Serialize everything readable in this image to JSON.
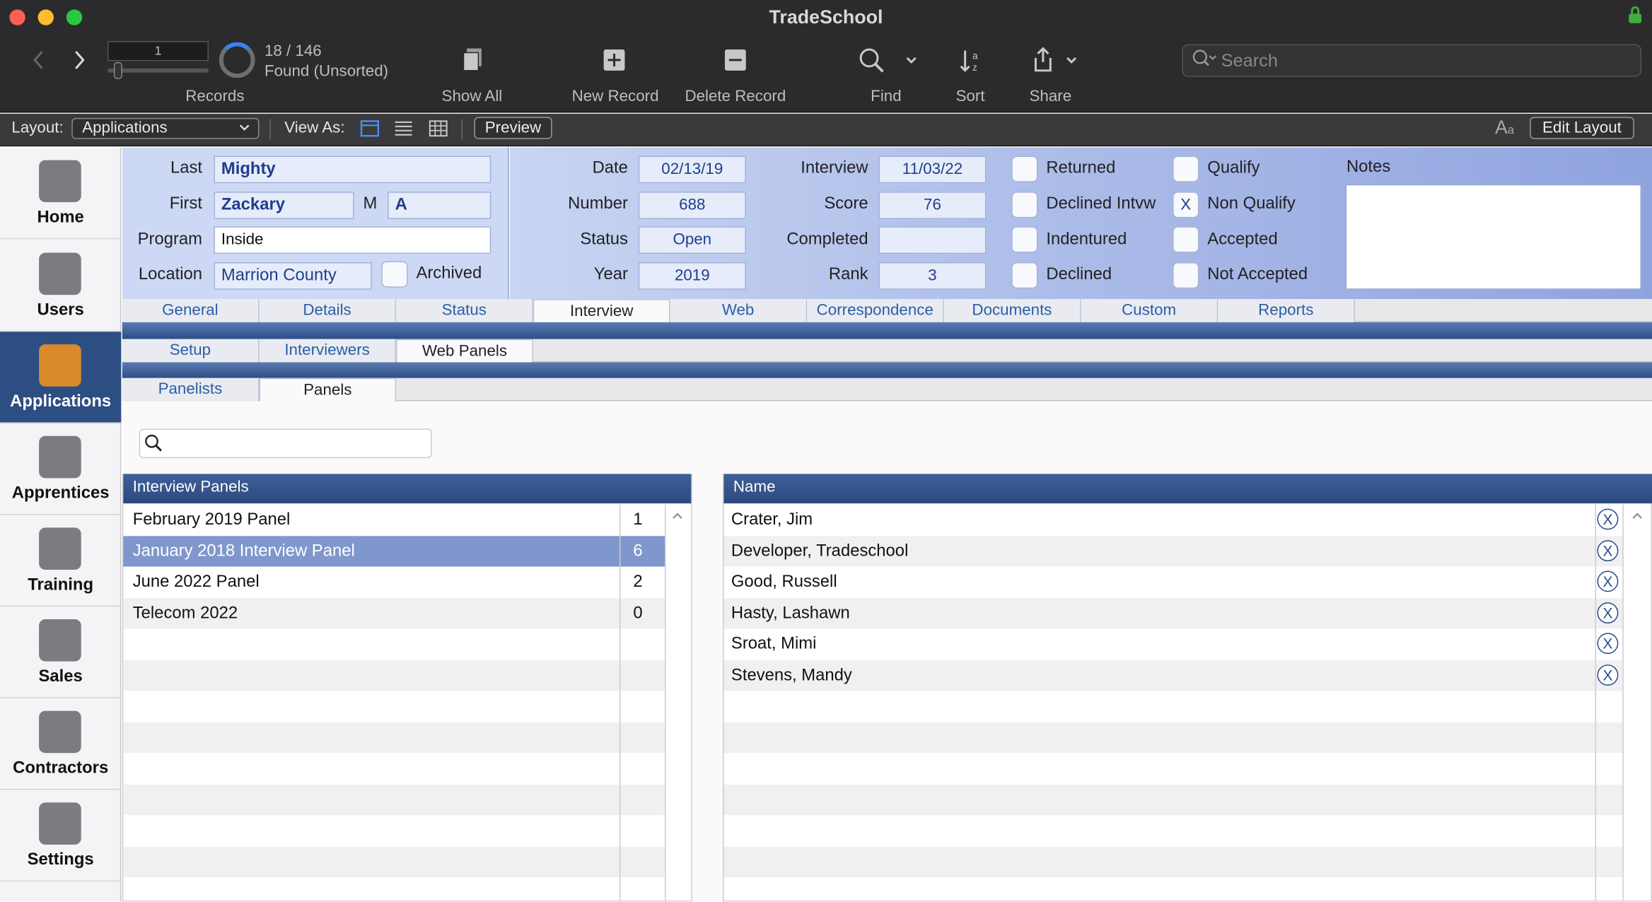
{
  "window": {
    "title": "TradeSchool"
  },
  "toolbar": {
    "record_number": "1",
    "found_count": "18 / 146",
    "found_status": "Found (Unsorted)",
    "records_label": "Records",
    "show_all_label": "Show All",
    "new_record_label": "New Record",
    "delete_record_label": "Delete Record",
    "find_label": "Find",
    "sort_label": "Sort",
    "share_label": "Share",
    "search_placeholder": "Search"
  },
  "layoutbar": {
    "layout_label": "Layout:",
    "layout_value": "Applications",
    "view_as_label": "View As:",
    "preview_label": "Preview",
    "edit_layout_label": "Edit Layout"
  },
  "sidebar": {
    "items": [
      {
        "label": "Home",
        "icon": "home-icon"
      },
      {
        "label": "Users",
        "icon": "address-book-icon"
      },
      {
        "label": "Applications",
        "icon": "clipboard-icon"
      },
      {
        "label": "Apprentices",
        "icon": "id-badge-icon"
      },
      {
        "label": "Training",
        "icon": "certificate-icon"
      },
      {
        "label": "Sales",
        "icon": "basket-icon"
      },
      {
        "label": "Contractors",
        "icon": "briefcase-icon"
      },
      {
        "label": "Settings",
        "icon": "wrench-icon"
      }
    ],
    "active": "Applications"
  },
  "record": {
    "last_label": "Last",
    "last": "Mighty",
    "first_label": "First",
    "first": "Zackary",
    "middle_label": "M",
    "middle": "A",
    "program_label": "Program",
    "program": "Inside",
    "location_label": "Location",
    "location": "Marrion County",
    "archived_label": "Archived",
    "date_label": "Date",
    "date": "02/13/19",
    "number_label": "Number",
    "number": "688",
    "status_label": "Status",
    "status": "Open",
    "year_label": "Year",
    "year": "2019",
    "interview_label": "Interview",
    "interview": "11/03/22",
    "score_label": "Score",
    "score": "76",
    "completed_label": "Completed",
    "completed": "",
    "rank_label": "Rank",
    "rank": "3",
    "checks": {
      "returned": {
        "label": "Returned",
        "mark": ""
      },
      "declined_intvw": {
        "label": "Declined Intvw",
        "mark": ""
      },
      "indentured": {
        "label": "Indentured",
        "mark": ""
      },
      "declined": {
        "label": "Declined",
        "mark": ""
      },
      "qualify": {
        "label": "Qualify",
        "mark": ""
      },
      "non_qualify": {
        "label": "Non Qualify",
        "mark": "X"
      },
      "accepted": {
        "label": "Accepted",
        "mark": ""
      },
      "not_accepted": {
        "label": "Not Accepted",
        "mark": ""
      }
    },
    "notes_label": "Notes",
    "notes": ""
  },
  "tabs": [
    "General",
    "Details",
    "Status",
    "Interview",
    "Web",
    "Correspondence",
    "Documents",
    "Custom",
    "Reports"
  ],
  "active_tab": "Interview",
  "subtabs": [
    "Setup",
    "Interviewers",
    "Web Panels"
  ],
  "active_subtab": "Web Panels",
  "subsubtabs": [
    "Panelists",
    "Panels"
  ],
  "active_subsubtab": "Panels",
  "panels": {
    "header": "Interview Panels",
    "rows": [
      {
        "name": "February 2019 Panel",
        "count": "1"
      },
      {
        "name": "January 2018 Interview Panel",
        "count": "6"
      },
      {
        "name": "June 2022 Panel",
        "count": "2"
      },
      {
        "name": "Telecom 2022",
        "count": "0"
      }
    ],
    "selected_index": 1
  },
  "members": {
    "header": "Name",
    "rows": [
      "Crater, Jim",
      "Developer, Tradeschool",
      "Good, Russell",
      "Hasty, Lashawn",
      "Sroat, Mimi",
      "Stevens, Mandy"
    ],
    "delete_glyph": "X"
  },
  "colors": {
    "accent": "#2d4e83",
    "selection": "#7f97cc",
    "toolbar": "#2b2b2d"
  }
}
